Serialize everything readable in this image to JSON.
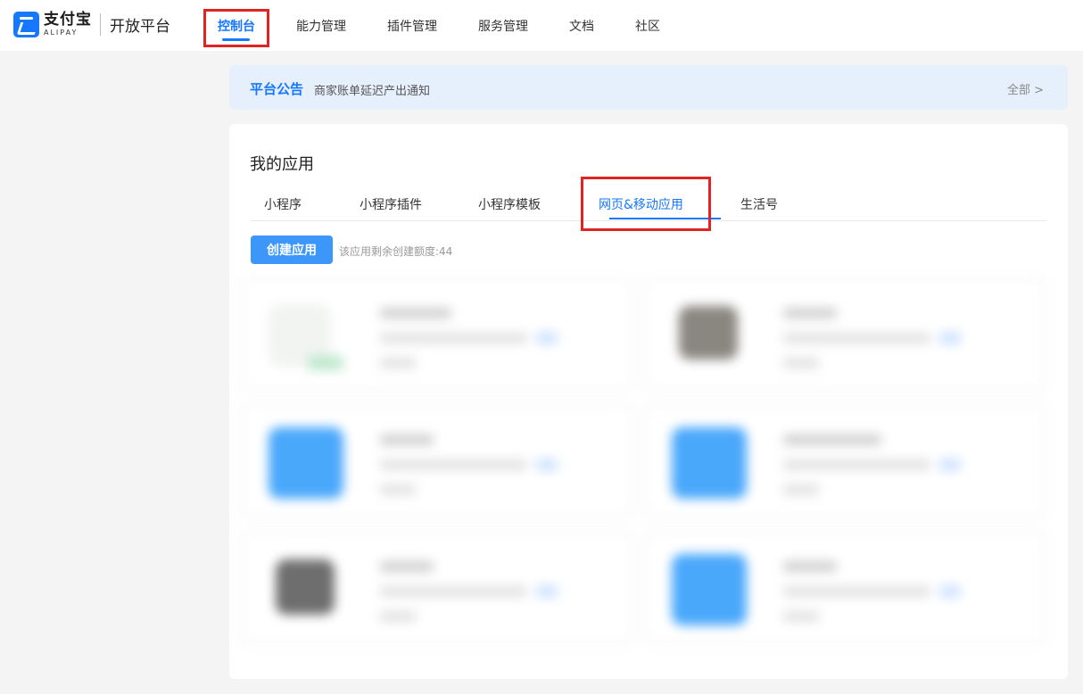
{
  "header": {
    "brand_cn": "支付宝",
    "brand_en": "ALIPAY",
    "platform": "开放平台",
    "nav": [
      "控制台",
      "能力管理",
      "插件管理",
      "服务管理",
      "文档",
      "社区"
    ],
    "active_nav": "控制台"
  },
  "notice": {
    "title": "平台公告",
    "text": "商家账单延迟产出通知",
    "all_link": "全部 >"
  },
  "apps_section": {
    "title": "我的应用",
    "tabs": [
      "小程序",
      "小程序插件",
      "小程序模板",
      "网页&移动应用",
      "生活号"
    ],
    "active_tab": "网页&移动应用",
    "create_button": "创建应用",
    "quota_text": "该应用剩余创建额度:44"
  },
  "colors": {
    "accent": "#1677ff",
    "highlight_box": "#e02323",
    "button": "#3d97fa"
  }
}
